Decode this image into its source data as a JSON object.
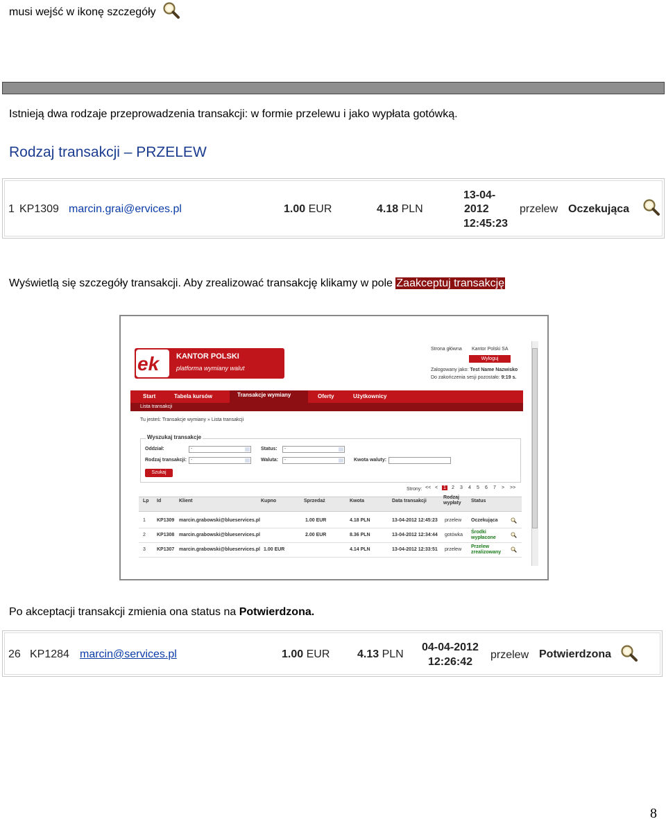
{
  "intro_line": "musi wejść w ikonę szczegóły",
  "para1": "Istnieją dwa rodzaje przeprowadzenia transakcji: w formie przelewu i jako wypłata gotówką.",
  "heading": "Rodzaj transakcji – PRZELEW",
  "row1": {
    "lp": "1",
    "id": "KP1309",
    "email": "marcin.grai@ervices.pl",
    "buy_num": "1.00",
    "buy_cur": "EUR",
    "sell_num": "4.18",
    "sell_cur": "PLN",
    "date_l1": "13-04-",
    "date_l2": "2012",
    "date_l3": "12:45:23",
    "type": "przelew",
    "status": "Oczekująca"
  },
  "para2_a": "Wyświetlą się szczegóły transakcji. Aby zrealizować transakcję klikamy w pole ",
  "para2_hl": "Zaakceptuj transakcję",
  "screenshot": {
    "logo_brand": "KANTOR POLSKI",
    "logo_sub": "platforma wymiany walut",
    "top_links": [
      "Strona główna",
      "Kantor Polski SA"
    ],
    "logout": "Wyloguj",
    "logged_as_label": "Zalogowany jako:",
    "logged_as_name": "Test Name Nazwisko",
    "session_label": "Do zakończenia sesji pozostało:",
    "session_time": "9:19 s.",
    "nav": [
      "Start",
      "Tabela kursów",
      "Transakcje wymiany",
      "Oferty",
      "Użytkownicy"
    ],
    "subnav": "Lista transakcji",
    "crumb": "Tu jesteś: Transakcje wymiany » Lista transakcji",
    "search_title": "Wyszukaj transakcje",
    "f_oddzial": "Oddział:",
    "f_status": "Status:",
    "f_rodzaj": "Rodzaj transakcji:",
    "f_waluta": "Waluta:",
    "f_kwota": "Kwota waluty:",
    "dash": "-",
    "search_btn": "Szukaj",
    "pages_label": "Strony:",
    "pages": [
      "<<",
      "<",
      "1",
      "2",
      "3",
      "4",
      "5",
      "6",
      "7",
      ">",
      ">>"
    ],
    "cols": [
      "Lp",
      "Id",
      "Klient",
      "Kupno",
      "Sprzedaż",
      "Kwota",
      "Data transakcji",
      "Rodzaj wypłaty",
      "Status"
    ],
    "rows": [
      {
        "lp": "1",
        "id": "KP1309",
        "klient": "marcin.grabowski@blueservices.pl",
        "kupno": "",
        "sprzedaz": "1.00 EUR",
        "kwota": "4.18 PLN",
        "data": "13-04-2012 12:45:23",
        "rodzaj": "przelew",
        "status": "Oczekująca"
      },
      {
        "lp": "2",
        "id": "KP1308",
        "klient": "marcin.grabowski@blueservices.pl",
        "kupno": "",
        "sprzedaz": "2.00 EUR",
        "kwota": "8.36 PLN",
        "data": "13-04-2012 12:34:44",
        "rodzaj": "gotówka",
        "status": "Środki wypłacone"
      },
      {
        "lp": "3",
        "id": "KP1307",
        "klient": "marcin.grabowski@blueservices.pl",
        "kupno": "1.00 EUR",
        "sprzedaz": "",
        "kwota": "4.14 PLN",
        "data": "13-04-2012 12:33:51",
        "rodzaj": "przelew",
        "status": "Przelew zrealizowany"
      }
    ]
  },
  "para3_a": "Po akceptacji transakcji zmienia ona status na ",
  "para3_b": "Potwierdzona.",
  "row2": {
    "lp": "26",
    "id": "KP1284",
    "email": "marcin@services.pl",
    "buy_num": "1.00",
    "buy_cur": "EUR",
    "sell_num": "4.13",
    "sell_cur": "PLN",
    "date_l1": "04-04-2012",
    "date_l2": "12:26:42",
    "type": "przelew",
    "status": "Potwierdzona"
  },
  "page_number": "8",
  "colors": {
    "brand_red": "#c0151b",
    "highlight": "#8b1010",
    "link": "#0a3ca8"
  }
}
